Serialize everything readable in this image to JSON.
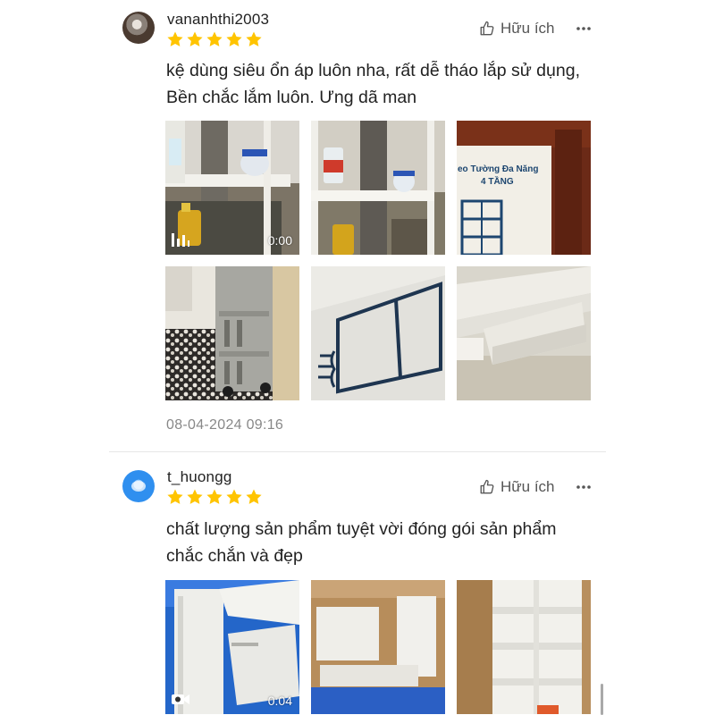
{
  "reviews": [
    {
      "username": "vananhthi2003",
      "rating": 5,
      "helpful_label": "Hữu ích",
      "text": "kệ dùng siêu ổn áp luôn nha, rất dễ tháo lắp sử dụng, Bền chắc lắm luôn. Ưng dã man",
      "timestamp": "08-04-2024 09:16",
      "media": [
        {
          "kind": "video",
          "duration": "0:00"
        },
        {
          "kind": "photo"
        },
        {
          "kind": "photo",
          "caption_lines": [
            "eo Tường Đa Năng",
            "4 TẦNG"
          ]
        },
        {
          "kind": "photo"
        },
        {
          "kind": "photo"
        },
        {
          "kind": "photo"
        }
      ]
    },
    {
      "username": "t_huongg",
      "rating": 5,
      "helpful_label": "Hữu ích",
      "text": "chất lượng sản phẩm tuyệt vời đóng gói sản phẩm chắc chắn và đẹp",
      "media": [
        {
          "kind": "video",
          "duration": "0:04"
        },
        {
          "kind": "photo"
        },
        {
          "kind": "photo"
        }
      ]
    }
  ],
  "colors": {
    "star": "#ffc400",
    "text": "#222222",
    "muted": "#888888",
    "divider": "#e6e6e6"
  },
  "icons": [
    "thumbs-up-icon",
    "more-dots-icon",
    "star-icon",
    "video-bars-icon",
    "video-camera-icon"
  ]
}
